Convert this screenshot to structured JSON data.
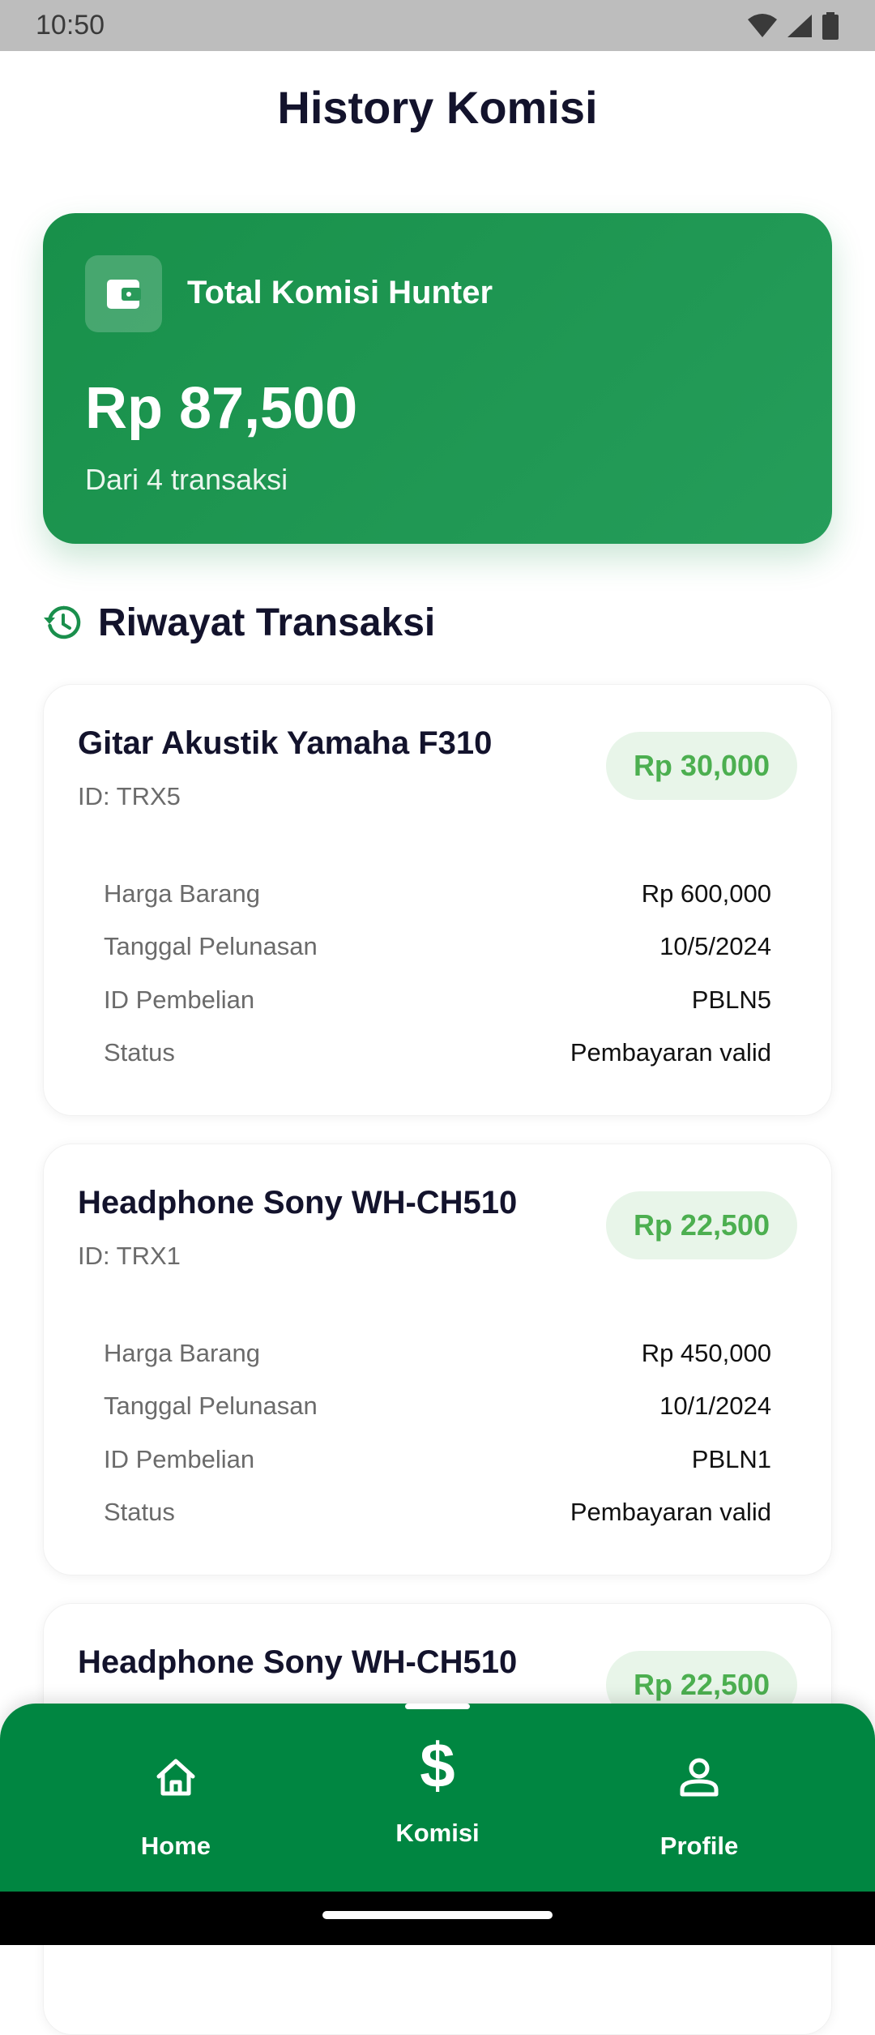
{
  "status_bar": {
    "time": "10:50"
  },
  "header": {
    "title": "History Komisi"
  },
  "summary": {
    "label": "Total Komisi Hunter",
    "amount": "Rp 87,500",
    "subtitle": "Dari 4 transaksi"
  },
  "section": {
    "title": "Riwayat Transaksi"
  },
  "transactions": [
    {
      "name": "Gitar Akustik Yamaha F310",
      "id": "ID: TRX5",
      "commission": "Rp 30,000",
      "details": [
        {
          "label": "Harga Barang",
          "value": "Rp 600,000"
        },
        {
          "label": "Tanggal Pelunasan",
          "value": "10/5/2024"
        },
        {
          "label": "ID Pembelian",
          "value": "PBLN5"
        },
        {
          "label": "Status",
          "value": "Pembayaran valid"
        }
      ]
    },
    {
      "name": "Headphone Sony WH-CH510",
      "id": "ID: TRX1",
      "commission": "Rp 22,500",
      "details": [
        {
          "label": "Harga Barang",
          "value": "Rp 450,000"
        },
        {
          "label": "Tanggal Pelunasan",
          "value": "10/1/2024"
        },
        {
          "label": "ID Pembelian",
          "value": "PBLN1"
        },
        {
          "label": "Status",
          "value": "Pembayaran valid"
        }
      ]
    },
    {
      "name": "Headphone Sony WH-CH510",
      "commission": "Rp 22,500"
    }
  ],
  "bottom_nav": {
    "items": [
      {
        "label": "Home",
        "icon": "home-icon",
        "active": false
      },
      {
        "label": "Komisi",
        "icon": "dollar-icon",
        "active": true
      },
      {
        "label": "Profile",
        "icon": "person-icon",
        "active": false
      }
    ]
  },
  "colors": {
    "primary_green": "#008641",
    "card_green": "#18904a",
    "badge_bg": "#e8f5e9",
    "badge_text": "#4caf50"
  }
}
